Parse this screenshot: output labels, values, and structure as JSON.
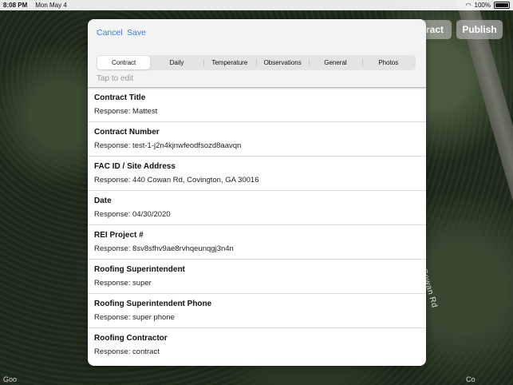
{
  "status_bar": {
    "time": "8:08 PM",
    "date": "Mon May 4",
    "battery": "100%"
  },
  "background": {
    "contract_button": "tract",
    "publish_button": "Publish",
    "road_label": "Cowan Rd",
    "corner_left": "Goo",
    "corner_right": "Co"
  },
  "modal": {
    "cancel_label": "Cancel",
    "save_label": "Save",
    "tabs": [
      {
        "label": "Contract",
        "active": true
      },
      {
        "label": "Daily"
      },
      {
        "label": "Temperature"
      },
      {
        "label": "Observations"
      },
      {
        "label": "General"
      },
      {
        "label": "Photos"
      }
    ],
    "hint": "Tap to edit",
    "fields": [
      {
        "title": "Contract Title",
        "response": "Response: Mattest"
      },
      {
        "title": "Contract Number",
        "response": "Response: test-1-j2n4kjnwfeodfsozd8aavqn"
      },
      {
        "title": "FAC ID / Site Address",
        "response": "Response: 440 Cowan Rd, Covington, GA 30016"
      },
      {
        "title": "Date",
        "response": "Response: 04/30/2020"
      },
      {
        "title": "REI Project #",
        "response": "Response: 8sv8sfhv9ae8rvhqeunqgj3n4n"
      },
      {
        "title": "Roofing Superintendent",
        "response": "Response: super"
      },
      {
        "title": "Roofing Superintendent Phone",
        "response": "Response: super phone"
      },
      {
        "title": "Roofing Contractor",
        "response": "Response: contract"
      }
    ]
  }
}
